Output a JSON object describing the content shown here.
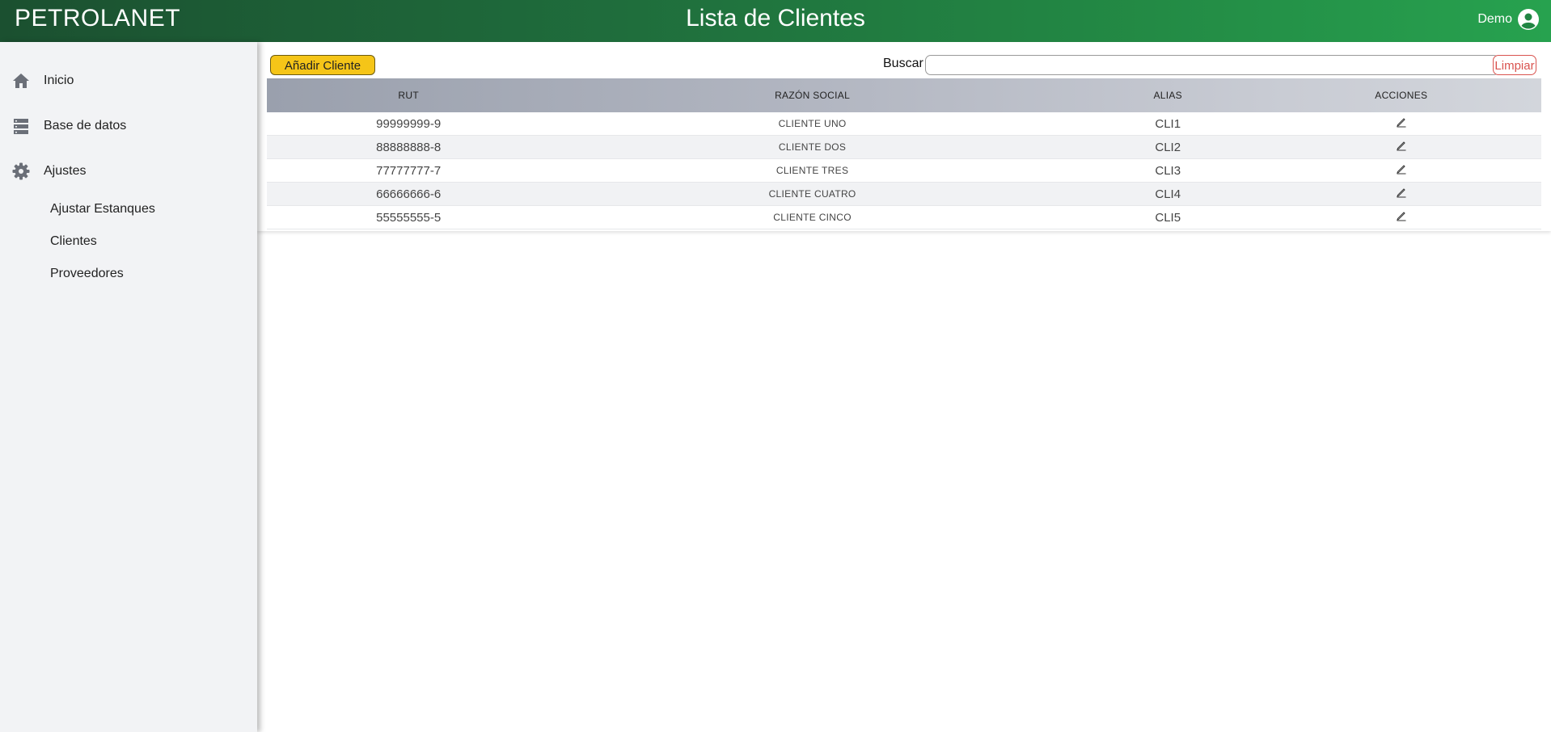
{
  "header": {
    "brand": "PETROLANET",
    "title": "Lista de Clientes",
    "user": "Demo"
  },
  "sidebar": {
    "items": [
      {
        "label": "Inicio",
        "icon": "home-icon"
      },
      {
        "label": "Base de datos",
        "icon": "database-icon"
      },
      {
        "label": "Ajustes",
        "icon": "gear-icon"
      }
    ],
    "subitems": [
      "Ajustar Estanques",
      "Clientes",
      "Proveedores"
    ]
  },
  "toolbar": {
    "add_label": "Añadir Cliente",
    "search_label": "Buscar",
    "search_value": "",
    "clear_label": "Limpiar"
  },
  "table": {
    "headers": [
      "RUT",
      "RAZÓN SOCIAL",
      "ALIAS",
      "ACCIONES"
    ],
    "rows": [
      {
        "rut": "99999999-9",
        "razon": "CLIENTE UNO",
        "alias": "CLI1"
      },
      {
        "rut": "88888888-8",
        "razon": "CLIENTE DOS",
        "alias": "CLI2"
      },
      {
        "rut": "77777777-7",
        "razon": "CLIENTE TRES",
        "alias": "CLI3"
      },
      {
        "rut": "66666666-6",
        "razon": "CLIENTE CUATRO",
        "alias": "CLI4"
      },
      {
        "rut": "55555555-5",
        "razon": "CLIENTE CINCO",
        "alias": "CLI5"
      }
    ]
  },
  "colors": {
    "header_start": "#1b5030",
    "header_end": "#27a24f",
    "add_button": "#f5c518",
    "clear_button": "#d9534f",
    "sidebar_bg": "#f2f3f5"
  }
}
